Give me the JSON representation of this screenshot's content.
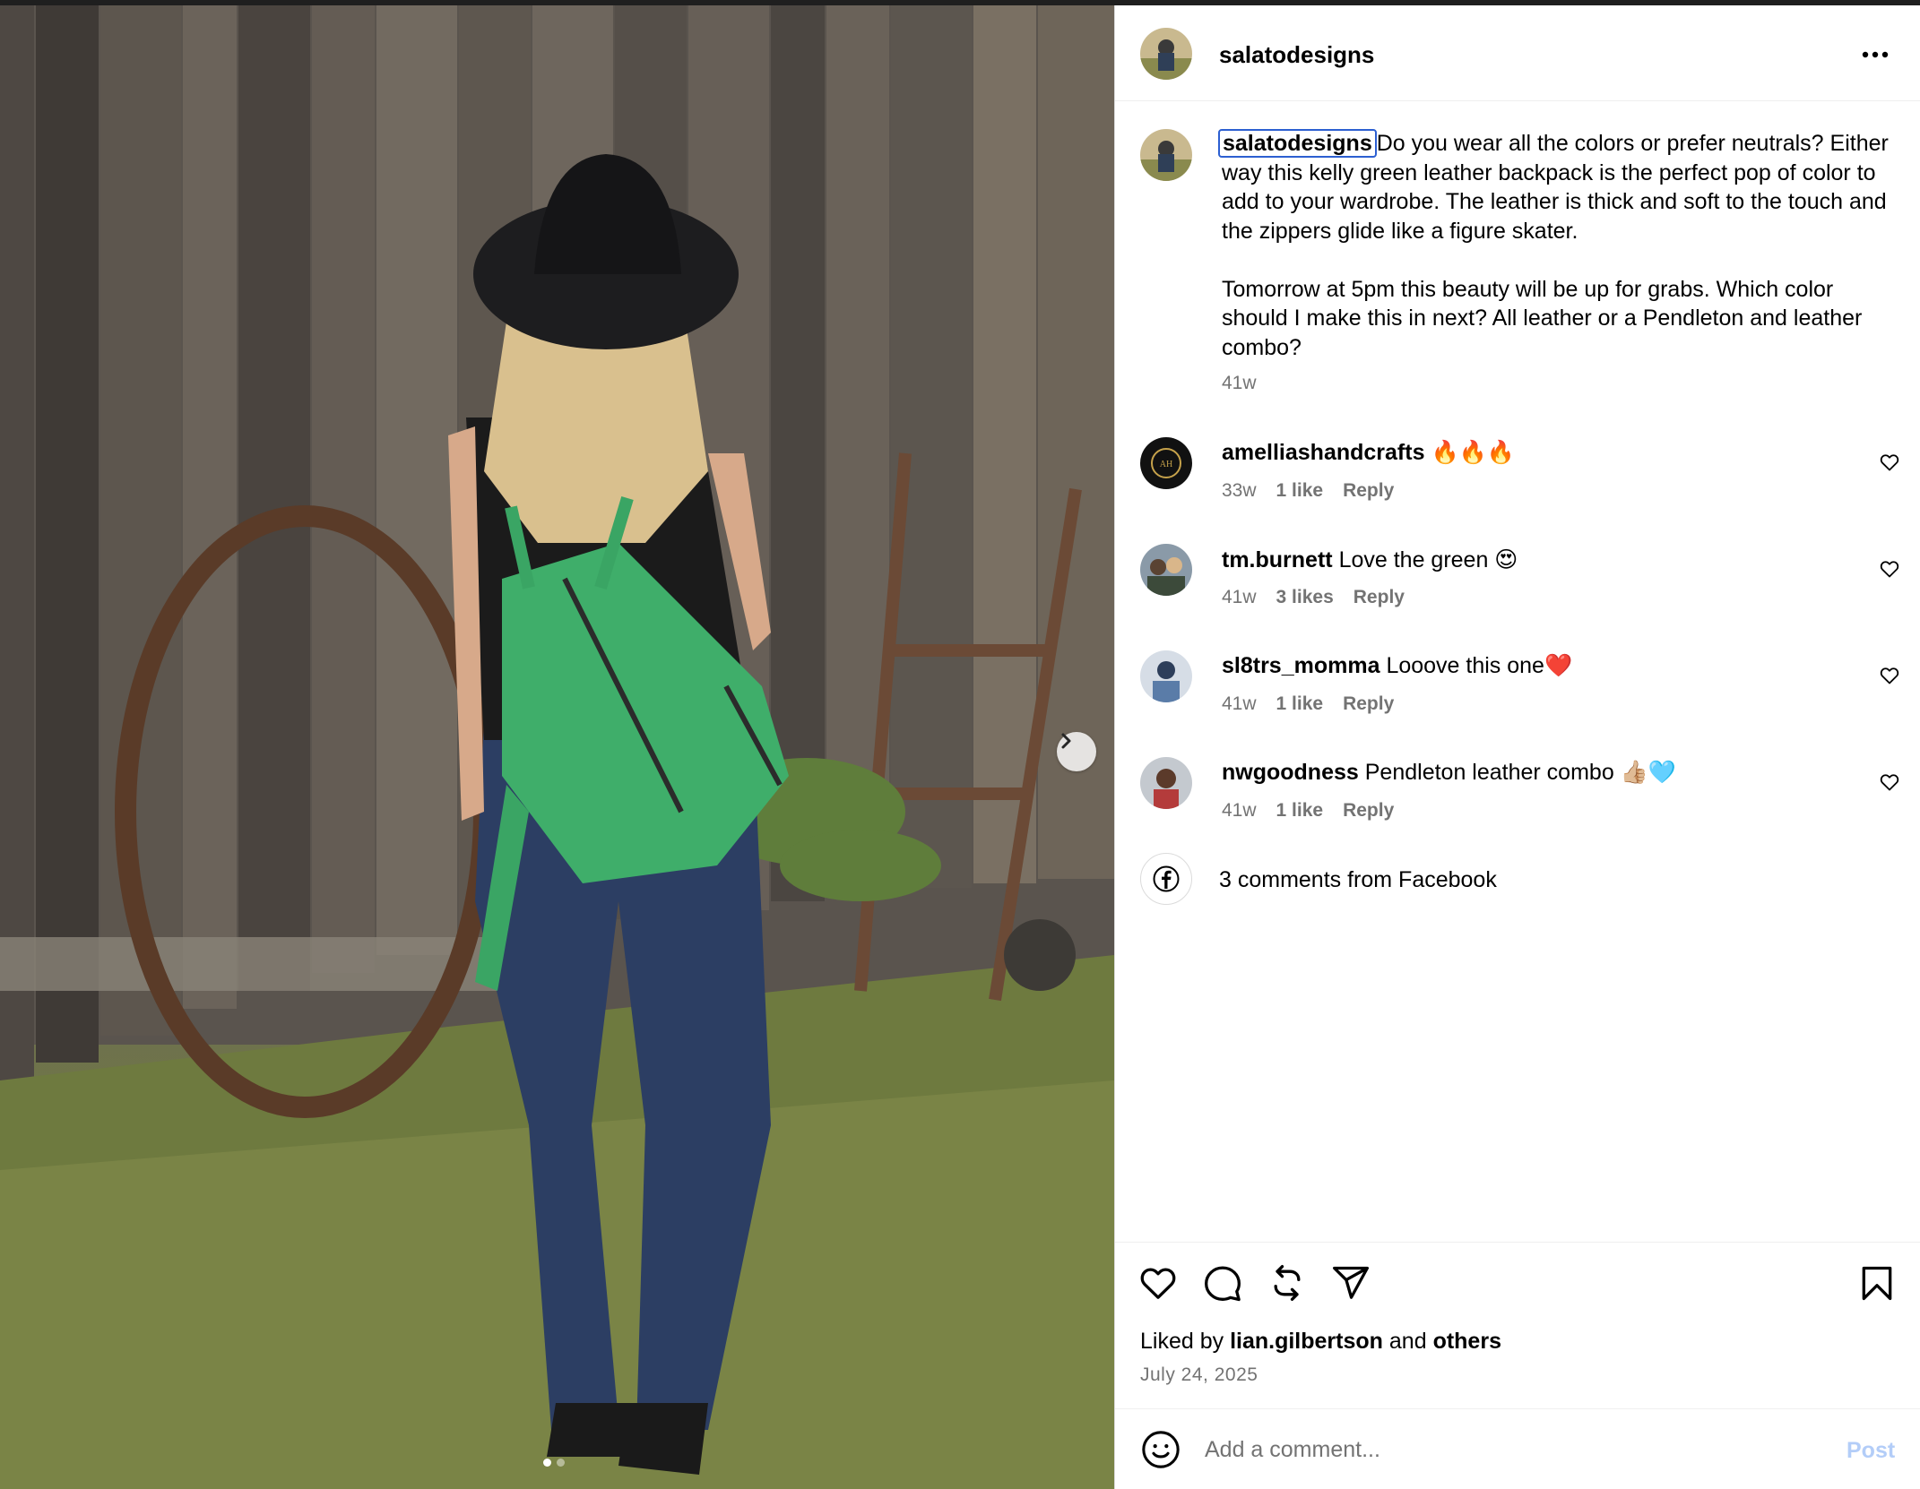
{
  "post": {
    "username": "salatodesigns",
    "caption": "Do you wear all the colors or prefer neutrals? Either way this kelly green leather backpack is the perfect pop of color to add to your wardrobe. The leather is thick and soft to the touch and the zippers glide like a figure skater.\n\nTomorrow at 5pm this beauty will be up for grabs. Which color should I make this in next? All leather or a Pendleton and leather combo?",
    "caption_time": "41w",
    "carousel": {
      "slide_count": 2,
      "current_slide": 1
    }
  },
  "comments": [
    {
      "user": "amelliashandcrafts",
      "text": "🔥🔥🔥",
      "time": "33w",
      "likes": "1 like",
      "reply": "Reply"
    },
    {
      "user": "tm.burnett",
      "text": "Love the green 😍",
      "time": "41w",
      "likes": "3 likes",
      "reply": "Reply"
    },
    {
      "user": "sl8trs_momma",
      "text": "Looove this one❤️",
      "time": "41w",
      "likes": "1 like",
      "reply": "Reply"
    },
    {
      "user": "nwgoodness",
      "text": "Pendleton leather combo 👍🏼🩵",
      "time": "41w",
      "likes": "1 like",
      "reply": "Reply"
    }
  ],
  "facebook_comments": "3 comments from Facebook",
  "likes": {
    "prefix": "Liked by",
    "user": "lian.gilbertson",
    "middle": "and",
    "others": "others"
  },
  "date": "July 24, 2025",
  "comment_box": {
    "placeholder": "Add a comment...",
    "post_label": "Post"
  },
  "icons": {
    "more": "more-horizontal-icon",
    "next": "chevron-right-icon",
    "like": "heart-icon",
    "comment": "comment-bubble-icon",
    "repost": "repost-icon",
    "share": "paper-plane-icon",
    "save": "bookmark-icon",
    "emoji": "smiley-icon",
    "facebook": "facebook-icon"
  },
  "colors": {
    "accent_blue_disabled": "#b3cdf8",
    "secondary_text": "#737373",
    "focus_outline": "#2c5fd1",
    "divider": "#efefef"
  }
}
